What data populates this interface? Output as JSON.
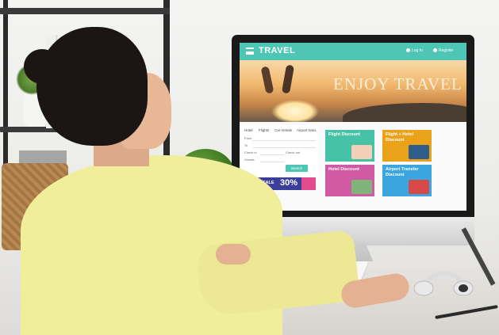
{
  "scene": {
    "description_text": "",
    "colors": {
      "site_header": "#4fc6b5",
      "shirt": "#f1ee9b",
      "monitor_bezel": "#1a1a1a"
    }
  },
  "website": {
    "title": "TRAVEL",
    "header_links": [
      "Log In",
      "Register"
    ],
    "hero_text": "ENJOY TRAVEL",
    "search_tabs": [
      "Hotel",
      "Flights",
      "Car rentals",
      "Airport trans"
    ],
    "form_labels": [
      "From",
      "To",
      "Check in",
      "Check out",
      "Guests"
    ],
    "search_button": "Search",
    "flash_sale_label": "FLASH SALE",
    "flash_sale_percent": "30%",
    "cards": [
      {
        "title": "Flight Discount",
        "color": "#46c2a6",
        "icon": "plane-icon"
      },
      {
        "title": "Flight + Hotel Discount",
        "color": "#e9a21a",
        "icon": "hotel-icon"
      },
      {
        "title": "Hotel Discount",
        "color": "#d15aa5",
        "icon": "bed-icon"
      },
      {
        "title": "Airport Transfer Discount",
        "color": "#3aa5df",
        "icon": "car-icon"
      }
    ]
  }
}
